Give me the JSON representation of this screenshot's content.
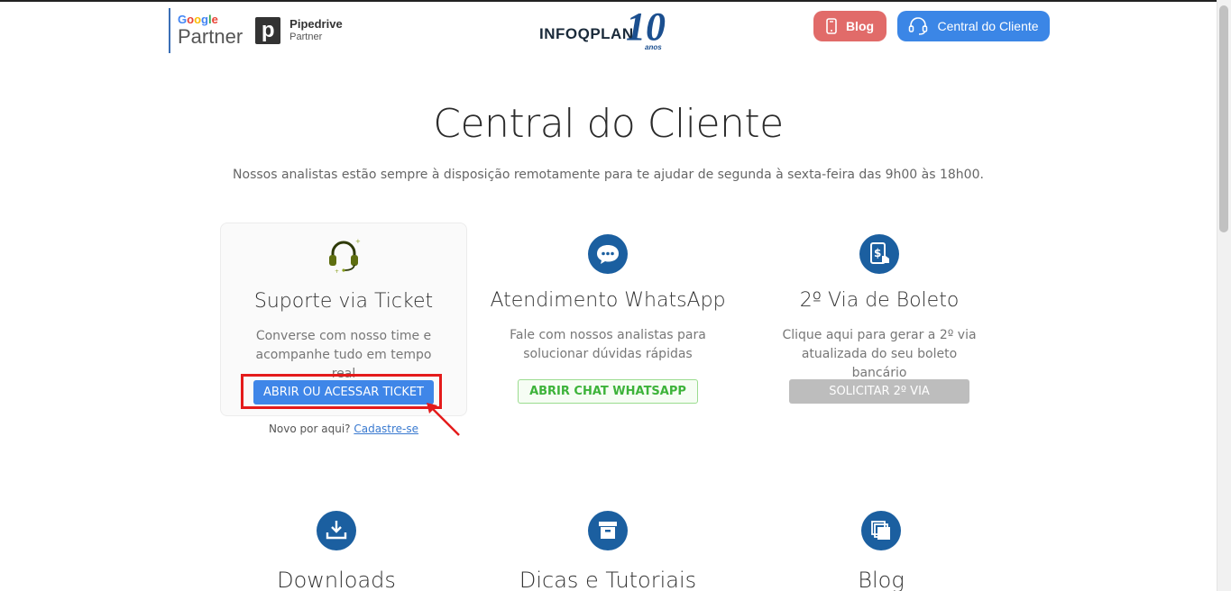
{
  "header": {
    "google_partner": {
      "google": "Google",
      "partner": "Partner"
    },
    "pipedrive_partner": {
      "letter": "p",
      "name": "Pipedrive",
      "sub": "Partner"
    },
    "brand": {
      "name": "INFOQPLAN",
      "years": "10",
      "anos": "anos"
    },
    "blog_button": "Blog",
    "central_button": "Central do Cliente"
  },
  "main": {
    "title": "Central do Cliente",
    "subtitle": "Nossos analistas estão sempre à disposição remotamente para te ajudar de segunda à sexta-feira das 9h00 às 18h00."
  },
  "cards": [
    {
      "title": "Suporte via Ticket",
      "desc": "Converse com nosso time e acompanhe tudo em tempo real",
      "button": "ABRIR OU ACESSAR TICKET",
      "icon": "headset-icon"
    },
    {
      "title": "Atendimento WhatsApp",
      "desc": "Fale com nossos analistas para solucionar dúvidas rápidas",
      "button": "ABRIR CHAT WHATSAPP",
      "icon": "chat-bubble-icon"
    },
    {
      "title": "2º Via de Boleto",
      "desc": "Clique aqui para gerar a 2º via atualizada do seu boleto bancário",
      "button": "SOLICITAR 2º VIA",
      "icon": "boleto-icon"
    }
  ],
  "signup": {
    "text": "Novo por aqui?",
    "link": "Cadastre-se"
  },
  "lower": [
    {
      "title": "Downloads",
      "icon": "download-icon"
    },
    {
      "title": "Dicas e Tutoriais",
      "icon": "archive-box-icon"
    },
    {
      "title": "Blog",
      "icon": "stacked-pages-icon"
    }
  ],
  "colors": {
    "blog": "#e16b69",
    "primary": "#3b86e6",
    "icon_circle": "#1b5fa0",
    "whatsapp_green": "#3db33a",
    "annotation_red": "#e41b1b"
  }
}
